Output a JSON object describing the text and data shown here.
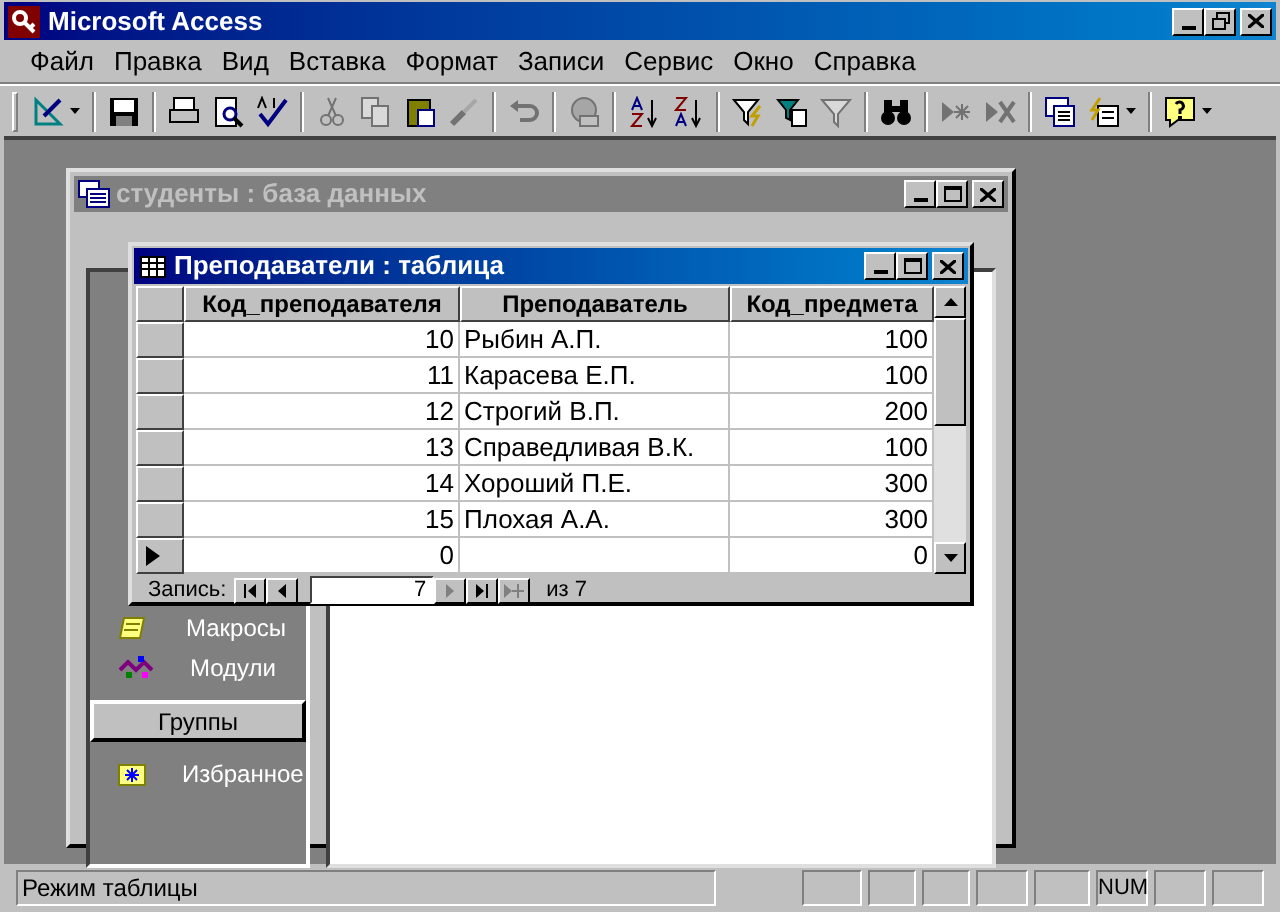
{
  "window": {
    "title": "Microsoft Access"
  },
  "menu": [
    "Файл",
    "Правка",
    "Вид",
    "Вставка",
    "Формат",
    "Записи",
    "Сервис",
    "Окно",
    "Справка"
  ],
  "toolbar": [
    [
      {
        "disabled": false,
        "dropdown": true
      }
    ],
    [
      {
        "disabled": false,
        "dropdown": false
      }
    ],
    [
      {
        "disabled": false,
        "dropdown": false
      },
      {
        "disabled": false,
        "dropdown": false
      },
      {
        "disabled": false,
        "dropdown": false
      }
    ],
    [
      {
        "disabled": true,
        "dropdown": false
      },
      {
        "disabled": true,
        "dropdown": false
      },
      {
        "disabled": false,
        "dropdown": false
      },
      {
        "disabled": true,
        "dropdown": false
      }
    ],
    [
      {
        "disabled": true,
        "dropdown": false
      }
    ],
    [
      {
        "disabled": true,
        "dropdown": false
      }
    ],
    [
      {
        "disabled": false,
        "dropdown": false
      },
      {
        "disabled": false,
        "dropdown": false
      }
    ],
    [
      {
        "disabled": false,
        "dropdown": false
      },
      {
        "disabled": false,
        "dropdown": false
      },
      {
        "disabled": true,
        "dropdown": false
      }
    ],
    [
      {
        "disabled": false,
        "dropdown": false
      }
    ],
    [
      {
        "disabled": true,
        "dropdown": false
      },
      {
        "disabled": true,
        "dropdown": false
      }
    ],
    [
      {
        "disabled": false,
        "dropdown": false
      },
      {
        "disabled": false,
        "dropdown": true
      }
    ],
    [
      {
        "disabled": false,
        "dropdown": true
      }
    ]
  ],
  "database_window": {
    "title": "студенты : база данных",
    "active": false,
    "objects": [
      {
        "label": "Макросы"
      },
      {
        "label": "Модули"
      }
    ],
    "groups_button": "Группы",
    "groups": [
      {
        "label": "Избранное"
      }
    ]
  },
  "table_window": {
    "title": "Преподаватели : таблица",
    "active": true,
    "columns": [
      "Код_преподавателя",
      "Преподаватель",
      "Код_предмета"
    ],
    "rows": [
      {
        "cells": [
          "10",
          "Рыбин А.П.",
          "100"
        ],
        "current": false
      },
      {
        "cells": [
          "11",
          "Карасева Е.П.",
          "100"
        ],
        "current": false
      },
      {
        "cells": [
          "12",
          "Строгий В.П.",
          "200"
        ],
        "current": false
      },
      {
        "cells": [
          "13",
          "Справедливая В.К.",
          "100"
        ],
        "current": false
      },
      {
        "cells": [
          "14",
          "Хороший П.Е.",
          "300"
        ],
        "current": false
      },
      {
        "cells": [
          "15",
          "Плохая А.А.",
          "300"
        ],
        "current": false
      },
      {
        "cells": [
          "0",
          "",
          "0"
        ],
        "current": true
      }
    ],
    "navigator": {
      "label": "Запись:",
      "record": "7",
      "total": "из 7"
    }
  },
  "status_bar": {
    "message": "Режим таблицы",
    "indicator": "NUM"
  }
}
